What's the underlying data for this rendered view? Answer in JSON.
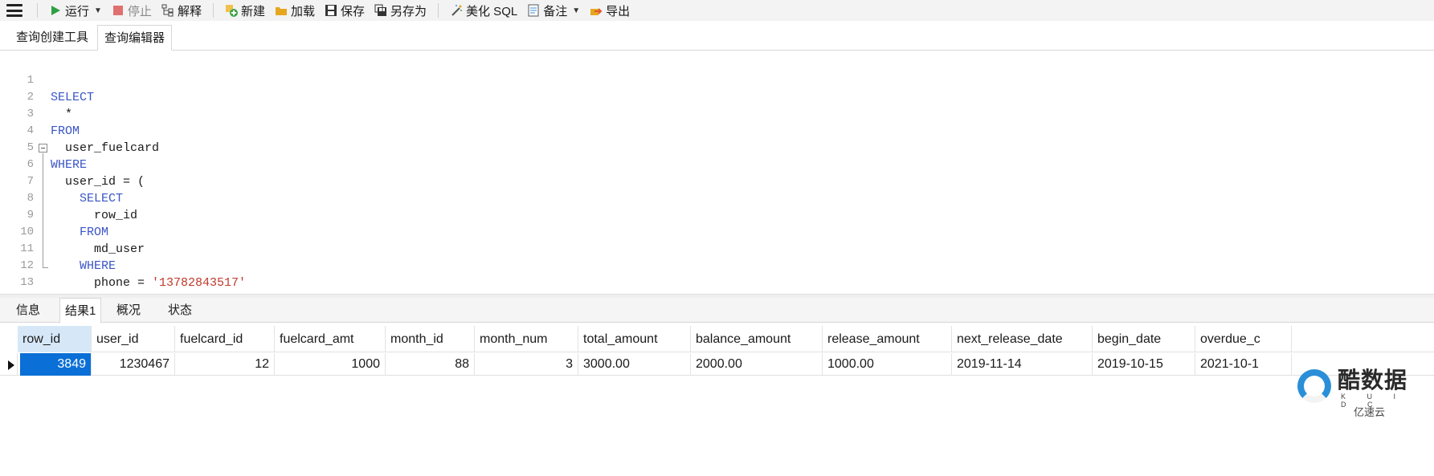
{
  "toolbar": {
    "menu_icon": "hamburger-menu-icon",
    "run_label": "运行",
    "stop_label": "停止",
    "explain_label": "解释",
    "new_label": "新建",
    "load_label": "加载",
    "save_label": "保存",
    "save_as_label": "另存为",
    "beautify_label": "美化 SQL",
    "note_label": "备注",
    "export_label": "导出",
    "colors": {
      "run": "#2ea043",
      "stop": "#e07070",
      "new": "#3da54a",
      "load": "#e6a61e",
      "export": "#e05a2a"
    }
  },
  "editor_tabs": [
    {
      "label": "查询创建工具",
      "active": false
    },
    {
      "label": "查询编辑器",
      "active": true
    }
  ],
  "code": {
    "colors": {
      "keyword": "#3a55c7",
      "string": "#c0392b",
      "line_number": "#9a9a9a"
    },
    "lines": [
      {
        "n": "1",
        "kw": "SELECT",
        "text": "",
        "str": ""
      },
      {
        "n": "2",
        "kw": "",
        "text": "  *",
        "str": ""
      },
      {
        "n": "3",
        "kw": "FROM",
        "text": "",
        "str": ""
      },
      {
        "n": "4",
        "kw": "",
        "text": "  user_fuelcard",
        "str": ""
      },
      {
        "n": "5",
        "kw": "WHERE",
        "text": "",
        "str": ""
      },
      {
        "n": "6",
        "kw": "",
        "text": "  user_id = (",
        "str": ""
      },
      {
        "n": "7",
        "kw": "    SELECT",
        "text": "",
        "str": ""
      },
      {
        "n": "8",
        "kw": "",
        "text": "      row_id",
        "str": ""
      },
      {
        "n": "9",
        "kw": "    FROM",
        "text": "",
        "str": ""
      },
      {
        "n": "10",
        "kw": "",
        "text": "      md_user",
        "str": ""
      },
      {
        "n": "11",
        "kw": "    WHERE",
        "text": "",
        "str": ""
      },
      {
        "n": "12",
        "kw": "",
        "text": "      phone = ",
        "str": "'13782843517'"
      },
      {
        "n": "13",
        "kw": "",
        "text": "  )",
        "str": ""
      }
    ]
  },
  "result_tabs": [
    {
      "label": "信息",
      "active": false
    },
    {
      "label": "结果1",
      "active": true
    },
    {
      "label": "概况",
      "active": false
    },
    {
      "label": "状态",
      "active": false
    }
  ],
  "grid": {
    "columns": [
      "row_id",
      "user_id",
      "fuelcard_id",
      "fuelcard_amt",
      "month_id",
      "month_num",
      "total_amount",
      "balance_amount",
      "release_amount",
      "next_release_date",
      "begin_date",
      "overdue_c"
    ],
    "rows": [
      [
        "3849",
        "1230467",
        "12",
        "1000",
        "88",
        "3",
        "3000.00",
        "2000.00",
        "1000.00",
        "2019-11-14",
        "2019-10-15",
        "2021-10-1"
      ]
    ],
    "selection_color": "#0a6fd6"
  },
  "watermark": {
    "title": "酷数据",
    "sub": "K U I D C",
    "corner": "亿速云",
    "logo_color": "#2a8fd8"
  }
}
